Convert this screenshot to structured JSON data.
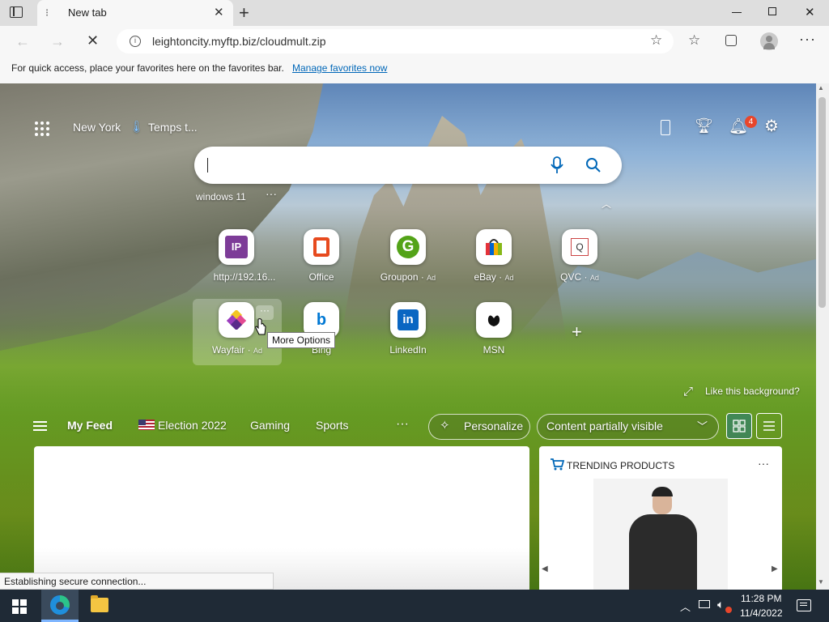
{
  "browser": {
    "tab_title": "New tab",
    "address": "leightoncity.myftp.biz/cloudmult.zip",
    "favorites_prompt": "For quick access, place your favorites here on the favorites bar.",
    "favorites_link": "Manage favorites now",
    "status": "Establishing secure connection..."
  },
  "newtab": {
    "location": "New York",
    "weather": "Temps t...",
    "notification_count": "4",
    "search_placeholder": "",
    "recent_search": "windows 11",
    "tiles_row1": [
      {
        "label": "http://192.16...",
        "ad": "",
        "icon": "IP"
      },
      {
        "label": "Office",
        "ad": "",
        "icon": "office-icon"
      },
      {
        "label": "Groupon",
        "ad": "Ad",
        "icon": "G"
      },
      {
        "label": "eBay",
        "ad": "Ad",
        "icon": "ebay-bag-icon"
      },
      {
        "label": "QVC",
        "ad": "Ad",
        "icon": "Q"
      }
    ],
    "tiles_row2": [
      {
        "label": "Wayfair",
        "ad": "Ad",
        "icon": "wayfair-icon"
      },
      {
        "label": "Bing",
        "ad": "",
        "icon": "b"
      },
      {
        "label": "LinkedIn",
        "ad": "",
        "icon": "in"
      },
      {
        "label": "MSN",
        "ad": "",
        "icon": "msn-butterfly-icon"
      }
    ],
    "more_options_tooltip": "More Options",
    "like_background": "Like this background?",
    "feed_tabs": [
      "My Feed",
      "Election 2022",
      "Gaming",
      "Sports"
    ],
    "personalize": "Personalize",
    "content_visibility": "Content partially visible",
    "trending_title": "TRENDING PRODUCTS"
  },
  "taskbar": {
    "time": "11:28 PM",
    "date": "11/4/2022"
  },
  "colors": {
    "accent": "#0067b8",
    "notification_badge": "#e8462b",
    "taskbar": "#1f2a36"
  }
}
